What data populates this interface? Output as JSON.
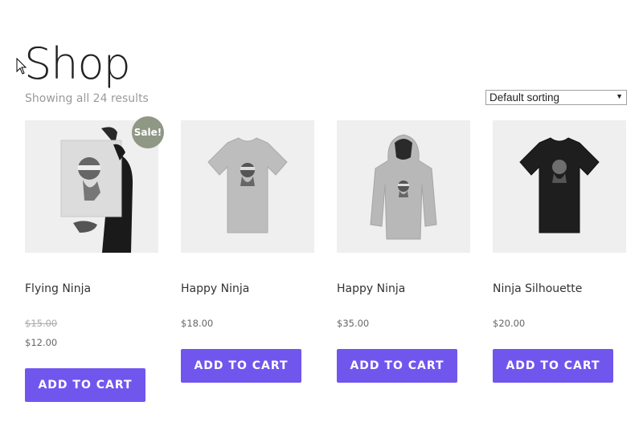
{
  "page": {
    "title": "Shop",
    "result_count": "Showing all 24 results",
    "sorting": "Default sorting"
  },
  "products": [
    {
      "name": "Flying Ninja",
      "price_old": "$15.00",
      "price": "$12.00",
      "badge": "Sale!",
      "button": "ADD TO CART"
    },
    {
      "name": "Happy Ninja",
      "price": "$18.00",
      "button": "ADD TO CART"
    },
    {
      "name": "Happy Ninja",
      "price": "$35.00",
      "button": "ADD TO CART"
    },
    {
      "name": "Ninja Silhouette",
      "price": "$20.00",
      "button": "ADD TO CART"
    }
  ],
  "colors": {
    "accent": "#7156ee",
    "sale_badge": "#8f9785",
    "thumb_bg": "#efefef"
  }
}
